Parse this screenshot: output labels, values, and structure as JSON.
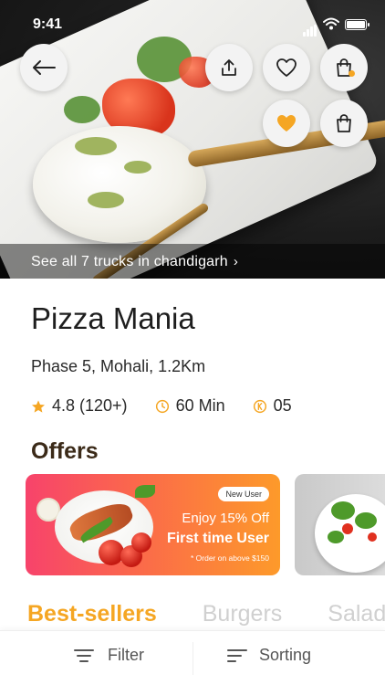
{
  "status_bar": {
    "time": "9:41"
  },
  "hero": {
    "see_all_text": "See all 7 trucks in chandigarh",
    "see_all_chevron": "›"
  },
  "actions": {
    "back_icon": "arrow-left-icon",
    "share_icon": "share-icon",
    "favorite_icon": "heart-outline-icon",
    "cart_icon": "shopping-bag-icon",
    "favorite_active_icon": "heart-filled-icon",
    "bag_icon": "shopping-bag-icon",
    "accent_color": "#f5a623"
  },
  "restaurant": {
    "name": "Pizza Mania",
    "address": "Phase 5, Mohali, 1.2Km",
    "rating": "4.8 (120+)",
    "delivery_time": "60 Min",
    "trucks": "05"
  },
  "offers": {
    "heading": "Offers",
    "cards": [
      {
        "badge": "New User",
        "line1": "Enjoy 15% Off",
        "line2": "First time User",
        "line3": "* Order on above $150"
      }
    ]
  },
  "categories": [
    "Best-sellers",
    "Burgers",
    "Salad"
  ],
  "bottom_bar": {
    "filter_label": "Filter",
    "sorting_label": "Sorting"
  }
}
